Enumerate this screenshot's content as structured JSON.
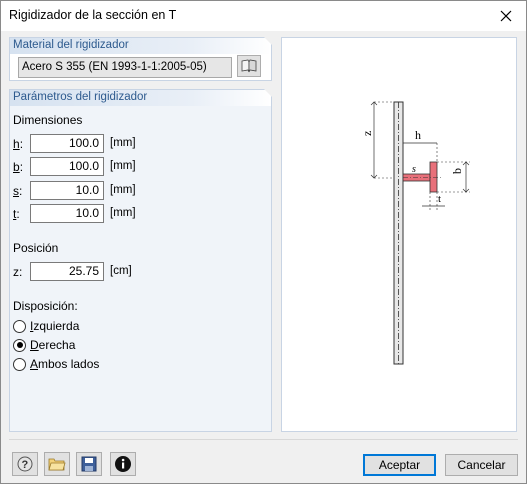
{
  "window": {
    "title": "Rigidizador de la sección en T"
  },
  "material": {
    "header": "Material del rigidizador",
    "value": "Acero S 355 (EN 1993-1-1:2005-05)"
  },
  "params": {
    "header": "Parámetros del rigidizador",
    "dimensions_label": "Dimensiones",
    "h": {
      "key": "h",
      "suffix": ":",
      "value": "100.0",
      "unit": "[mm]"
    },
    "b": {
      "key": "b",
      "suffix": ":",
      "value": "100.0",
      "unit": "[mm]"
    },
    "s": {
      "key": "s",
      "suffix": ":",
      "value": "10.0",
      "unit": "[mm]"
    },
    "t": {
      "key": "t",
      "suffix": ":",
      "value": "10.0",
      "unit": "[mm]"
    },
    "position_label": "Posición",
    "z": {
      "key": "z:",
      "value": "25.75",
      "unit": "[cm]"
    },
    "disposition_label": "Disposición:",
    "options": [
      {
        "first": "I",
        "rest": "zquierda",
        "checked": false
      },
      {
        "first": "D",
        "rest": "erecha",
        "checked": true
      },
      {
        "first": "A",
        "rest": "mbos lados",
        "checked": false
      }
    ]
  },
  "diagram": {
    "z": "z",
    "h": "h",
    "s": "s",
    "b": "b",
    "t": "t"
  },
  "buttons": {
    "accept": "Aceptar",
    "cancel": "Cancelar"
  },
  "colors": {
    "stiffener": "#e8707a",
    "header_text": "#2d5a8e",
    "accent": "#0078d7"
  }
}
